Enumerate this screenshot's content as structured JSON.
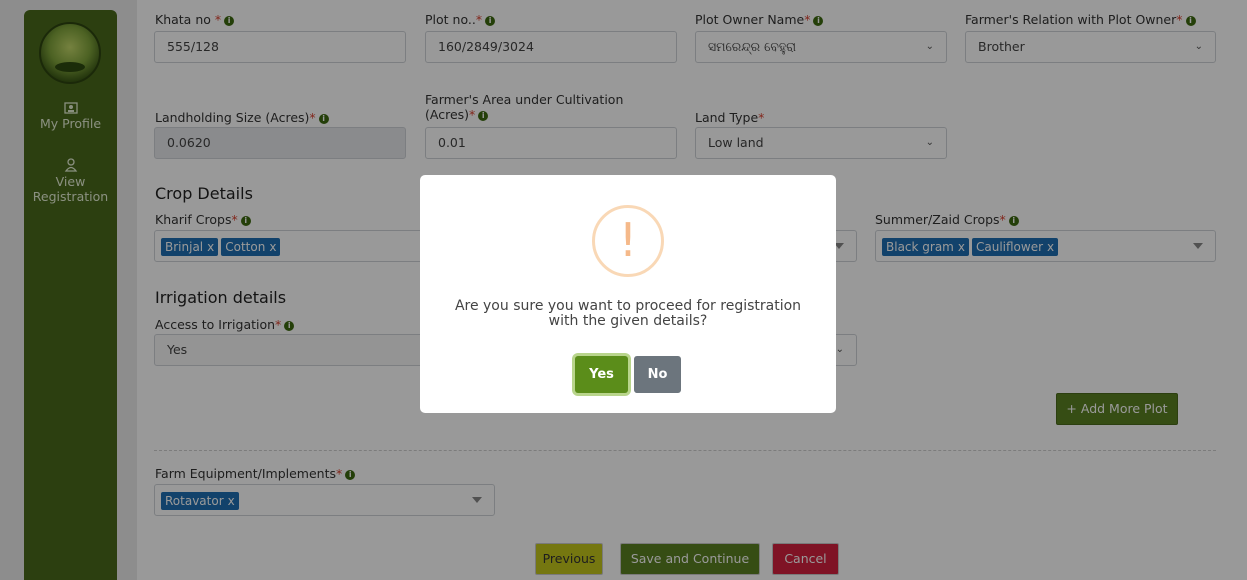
{
  "sidebar": {
    "items": [
      {
        "label": "My Profile",
        "icon": "profile-card-icon"
      },
      {
        "label": "View Registration",
        "icon": "person-icon"
      }
    ]
  },
  "plot": {
    "khata_label": "Khata no",
    "khata_value": "555/128",
    "plot_label": "Plot no..",
    "plot_value": "160/2849/3024",
    "owner_label": "Plot Owner Name",
    "owner_value": "ସମରେନ୍ଦ୍ର ବେହୁରା",
    "relation_label": "Farmer's Relation with Plot Owner",
    "relation_value": "Brother",
    "landholding_label": "Landholding Size (Acres)",
    "landholding_value": "0.0620",
    "cultivation_label_1": "Farmer's Area under Cultivation",
    "cultivation_label_2": "(Acres)",
    "cultivation_value": "0.01",
    "landtype_label": "Land Type",
    "landtype_value": "Low land"
  },
  "crops": {
    "title": "Crop Details",
    "kharif_label": "Kharif Crops",
    "kharif_tags": [
      "Brinjal",
      "Cotton"
    ],
    "summer_label": "Summer/Zaid Crops",
    "summer_tags": [
      "Black gram",
      "Cauliflower"
    ]
  },
  "irrigation": {
    "title": "Irrigation details",
    "access_label": "Access to Irrigation",
    "access_value": "Yes"
  },
  "add_more_plot": "+ Add More Plot",
  "equipment": {
    "label": "Farm Equipment/Implements",
    "tags": [
      "Rotavator"
    ]
  },
  "footer": {
    "previous": "Previous",
    "save_continue": "Save and Continue",
    "cancel": "Cancel"
  },
  "modal": {
    "line1": "Are you sure you want to proceed for registration",
    "line2": "with the given details?",
    "yes": "Yes",
    "no": "No"
  },
  "colors": {
    "sidebar": "#4a6a1c",
    "tag": "#1f6fb2",
    "yes": "#5b8d1a",
    "no": "#6c757d",
    "previous": "#c4c71c",
    "save": "#5b8022",
    "cancel": "#d4213e"
  }
}
